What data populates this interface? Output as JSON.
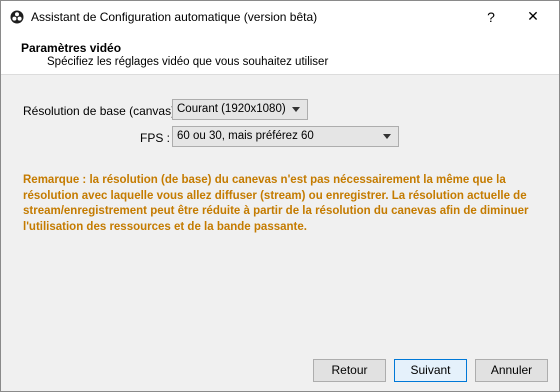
{
  "window": {
    "title": "Assistant de Configuration automatique (version bêta)",
    "help_glyph": "?",
    "close_glyph": "✕",
    "icon": "obs-logo-icon"
  },
  "header": {
    "title": "Paramètres vidéo",
    "subtitle": "Spécifiez les réglages vidéo que vous souhaitez utiliser"
  },
  "form": {
    "resolution_label": "Résolution de base (canvas) :",
    "resolution_value": "Courant (1920x1080)",
    "fps_label": "FPS :",
    "fps_value": "60 ou 30, mais préférez 60"
  },
  "note": {
    "text": "Remarque : la résolution (de base) du canevas n'est pas nécessairement la même que la résolution avec laquelle vous allez diffuser (stream) ou enregistrer. La résolution actuelle de stream/enregistrement peut être réduite à partir de la résolution du canevas afin de diminuer  l'utilisation des ressources et de la bande passante.",
    "color": "#c47b00"
  },
  "buttons": {
    "back": "Retour",
    "next": "Suivant",
    "cancel": "Annuler"
  }
}
